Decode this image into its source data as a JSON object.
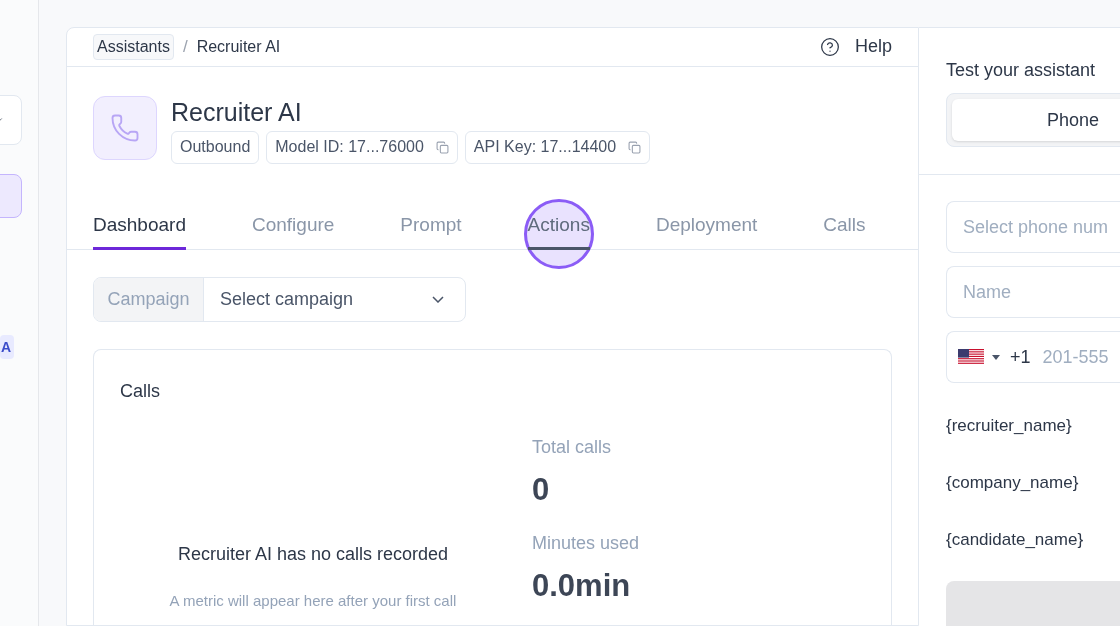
{
  "sidebar": {
    "badge": "A"
  },
  "breadcrumb": {
    "items": [
      "Assistants",
      "Recruiter AI"
    ],
    "separator": "/",
    "help": "Help"
  },
  "assistant": {
    "name": "Recruiter AI",
    "tags": [
      {
        "label": "Outbound",
        "kind": "plain"
      },
      {
        "label": "Model ID: 17...76000",
        "kind": "copy"
      },
      {
        "label": "API Key: 17...14400",
        "kind": "copy"
      }
    ]
  },
  "tabs": [
    {
      "label": "Dashboard",
      "selected": true,
      "hovered": false,
      "clicked": false
    },
    {
      "label": "Configure",
      "selected": false,
      "hovered": false,
      "clicked": false
    },
    {
      "label": "Prompt",
      "selected": false,
      "hovered": false,
      "clicked": false
    },
    {
      "label": "Actions",
      "selected": false,
      "hovered": true,
      "clicked": true
    },
    {
      "label": "Deployment",
      "selected": false,
      "hovered": false,
      "clicked": false
    },
    {
      "label": "Calls",
      "selected": false,
      "hovered": false,
      "clicked": false
    }
  ],
  "campaign": {
    "label": "Campaign",
    "placeholder": "Select campaign"
  },
  "calls_card": {
    "title": "Calls",
    "empty_title": "Recruiter AI has no calls recorded",
    "empty_hint": "A metric will appear here after your first call",
    "stats": [
      {
        "label": "Total calls",
        "value": "0"
      },
      {
        "label": "Minutes used",
        "value": "0.0min"
      }
    ]
  },
  "test_panel": {
    "title": "Test your assistant",
    "modes": [
      {
        "label": "Phone",
        "selected": true
      }
    ],
    "phone_select": {
      "placeholder": "Select phone num"
    },
    "name_field": {
      "placeholder": "Name"
    },
    "phone_field": {
      "code": "+1",
      "placeholder": "201-555"
    },
    "variables": [
      "{recruiter_name}",
      "{company_name}",
      "{candidate_name}"
    ]
  }
}
